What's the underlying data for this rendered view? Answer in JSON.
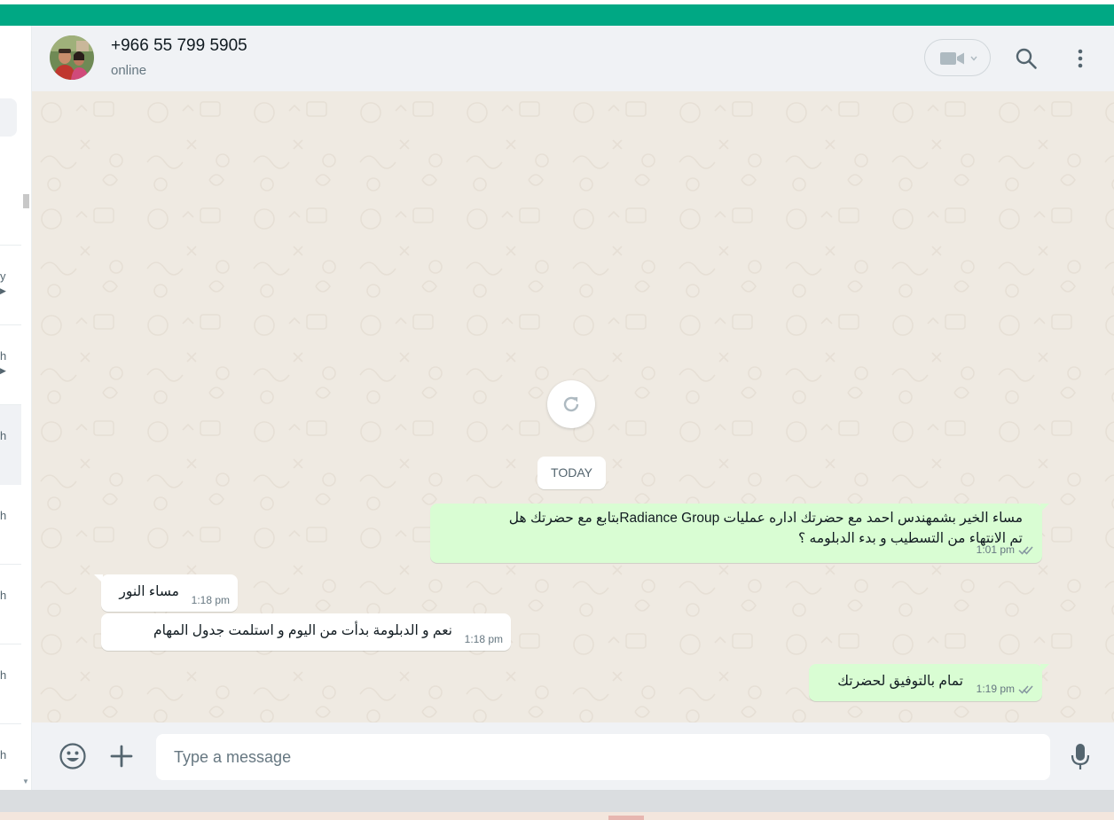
{
  "header": {
    "contact_name": "+966 55 799 5905",
    "contact_status": "online",
    "icons": [
      "video-call-icon",
      "chevron-down-icon",
      "search-icon",
      "menu-icon"
    ]
  },
  "sidebar": {
    "partial_labels": [
      "y",
      "h",
      "h",
      "h",
      "h",
      "h",
      "h"
    ]
  },
  "chat": {
    "day_label": "TODAY",
    "messages": [
      {
        "direction": "outgoing",
        "lines": [
          "مساء الخير بشمهندس احمد مع  حضرتك اداره عمليات Radiance Groupبتابع مع حضرتك هل",
          "تم الانتهاء من التسطيب و بدء الدبلومه ؟"
        ],
        "time": "1:01 pm",
        "status": "read"
      },
      {
        "direction": "incoming",
        "lines": [
          "مساء النور"
        ],
        "time": "1:18 pm"
      },
      {
        "direction": "incoming",
        "lines": [
          "نعم و الدبلومة بدأت من اليوم و استلمت جدول المهام"
        ],
        "time": "1:18 pm"
      },
      {
        "direction": "outgoing",
        "lines": [
          "تمام بالتوفيق لحضرتك"
        ],
        "time": "1:19 pm",
        "status": "read"
      }
    ]
  },
  "composer": {
    "placeholder": "Type a message",
    "value": ""
  },
  "colors": {
    "brand_green": "#00a884",
    "outgoing_bubble": "#d9fdd3",
    "incoming_bubble": "#ffffff",
    "chat_background": "#efeae2",
    "read_ticks": "#8696a0"
  }
}
